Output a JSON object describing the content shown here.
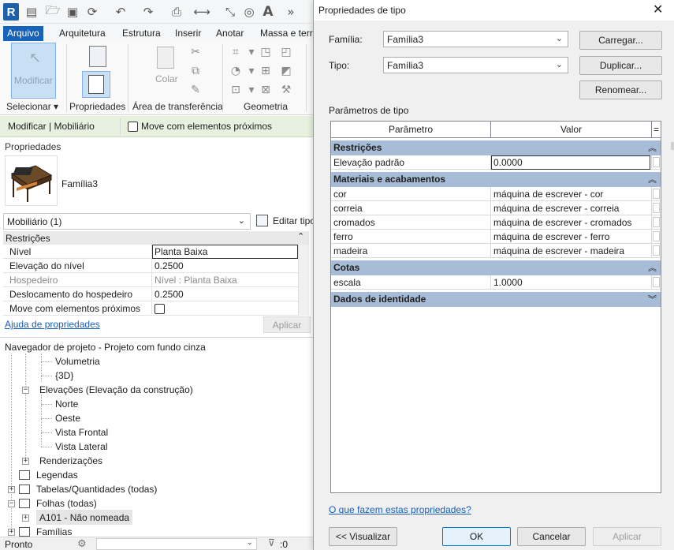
{
  "app": {
    "logo_letter": "R",
    "tabs": [
      "Arquivo",
      "Arquitetura",
      "Estrutura",
      "Inserir",
      "Anotar",
      "Massa e terre"
    ],
    "active_tab": "Arquivo",
    "ribbon": {
      "modify_label": "Modificar",
      "select_label": "Selecionar",
      "properties_label": "Propriedades",
      "clipboard_label": "Área de transferência",
      "paste_label": "Colar",
      "geometry_label": "Geometria"
    },
    "modify_bar": {
      "context": "Modificar | Mobiliário",
      "checkbox_label": "Move com elementos próximos"
    },
    "status_text": "Pronto",
    "status_zero": ":0"
  },
  "properties": {
    "title": "Propriedades",
    "family_name": "Família3",
    "category_selector": "Mobiliário (1)",
    "edit_type": "Editar tipo",
    "section": "Restrições",
    "rows": [
      {
        "key": "Nível",
        "value": "Planta Baixa",
        "grey": false
      },
      {
        "key": "Elevação do nível",
        "value": "0.2500",
        "grey": false
      },
      {
        "key": "Hospedeiro",
        "value": "Nível : Planta Baixa",
        "grey": true
      },
      {
        "key": "Deslocamento do hospedeiro",
        "value": "0.2500",
        "grey": false
      },
      {
        "key": "Move com elementos próximos",
        "value": "",
        "grey": false
      }
    ],
    "help_link": "Ajuda de propriedades",
    "apply": "Aplicar"
  },
  "browser": {
    "title": "Navegador de projeto - Projeto com fundo cinza",
    "items": [
      {
        "label": "Volumetria"
      },
      {
        "label": "{3D}"
      },
      {
        "label": "Elevações (Elevação da construção)"
      },
      {
        "label": "Norte"
      },
      {
        "label": "Oeste"
      },
      {
        "label": "Vista Frontal"
      },
      {
        "label": "Vista Lateral"
      },
      {
        "label": "Renderizações"
      },
      {
        "label": "Legendas"
      },
      {
        "label": "Tabelas/Quantidades (todas)"
      },
      {
        "label": "Folhas (todas)"
      },
      {
        "label": "A101 - Não nomeada"
      },
      {
        "label": "Famílias"
      }
    ]
  },
  "dialog": {
    "title": "Propriedades de tipo",
    "family_label": "Família:",
    "family_value": "Família3",
    "type_label": "Tipo:",
    "type_value": "Família3",
    "load": "Carregar...",
    "duplicate": "Duplicar...",
    "rename": "Renomear...",
    "params_label": "Parâmetros de tipo",
    "col_param": "Parâmetro",
    "col_value": "Valor",
    "col_eq": "=",
    "sections": [
      {
        "name": "Restrições",
        "rows": [
          {
            "k": "Elevação padrão",
            "v": "0.0000"
          }
        ]
      },
      {
        "name": "Materiais e acabamentos",
        "rows": [
          {
            "k": "cor",
            "v": "máquina de escrever - cor"
          },
          {
            "k": "correia",
            "v": "máquina de escrever - correia"
          },
          {
            "k": "cromados",
            "v": "máquina de escrever - cromados"
          },
          {
            "k": "ferro",
            "v": "máquina de escrever - ferro"
          },
          {
            "k": "madeira",
            "v": "máquina de escrever - madeira"
          }
        ]
      },
      {
        "name": "Cotas",
        "rows": [
          {
            "k": "escala",
            "v": "1.0000"
          }
        ]
      },
      {
        "name": "Dados de identidade",
        "rows": []
      }
    ],
    "help_link": "O que fazem estas propriedades?",
    "preview": "<< Visualizar",
    "ok": "OK",
    "cancel": "Cancelar",
    "apply": "Aplicar"
  }
}
